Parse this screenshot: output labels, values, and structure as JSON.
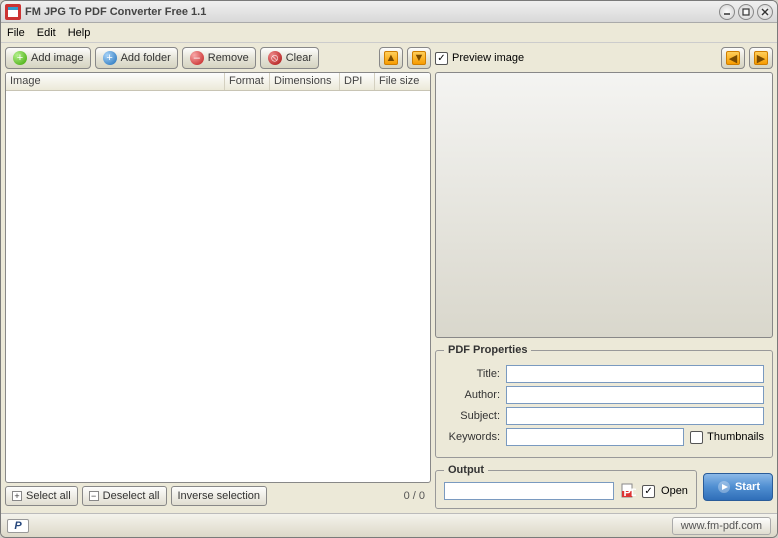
{
  "window": {
    "title": "FM JPG To PDF Converter Free 1.1"
  },
  "menu": {
    "file": "File",
    "edit": "Edit",
    "help": "Help"
  },
  "toolbar": {
    "add_image": "Add image",
    "add_folder": "Add folder",
    "remove": "Remove",
    "clear": "Clear"
  },
  "columns": {
    "image": "Image",
    "format": "Format",
    "dimensions": "Dimensions",
    "dpi": "DPI",
    "filesize": "File size"
  },
  "bottom": {
    "select_all": "Select all",
    "deselect_all": "Deselect all",
    "inverse": "Inverse selection",
    "count": "0 / 0"
  },
  "preview": {
    "label": "Preview image",
    "checked": true
  },
  "properties": {
    "legend": "PDF Properties",
    "title_label": "Title:",
    "author_label": "Author:",
    "subject_label": "Subject:",
    "keywords_label": "Keywords:",
    "thumbnails_label": "Thumbnails",
    "title": "",
    "author": "",
    "subject": "",
    "keywords": "",
    "thumbnails_checked": false
  },
  "output": {
    "legend": "Output",
    "path": "",
    "open_label": "Open",
    "open_checked": true
  },
  "start": {
    "label": "Start"
  },
  "footer": {
    "url": "www.fm-pdf.com"
  }
}
